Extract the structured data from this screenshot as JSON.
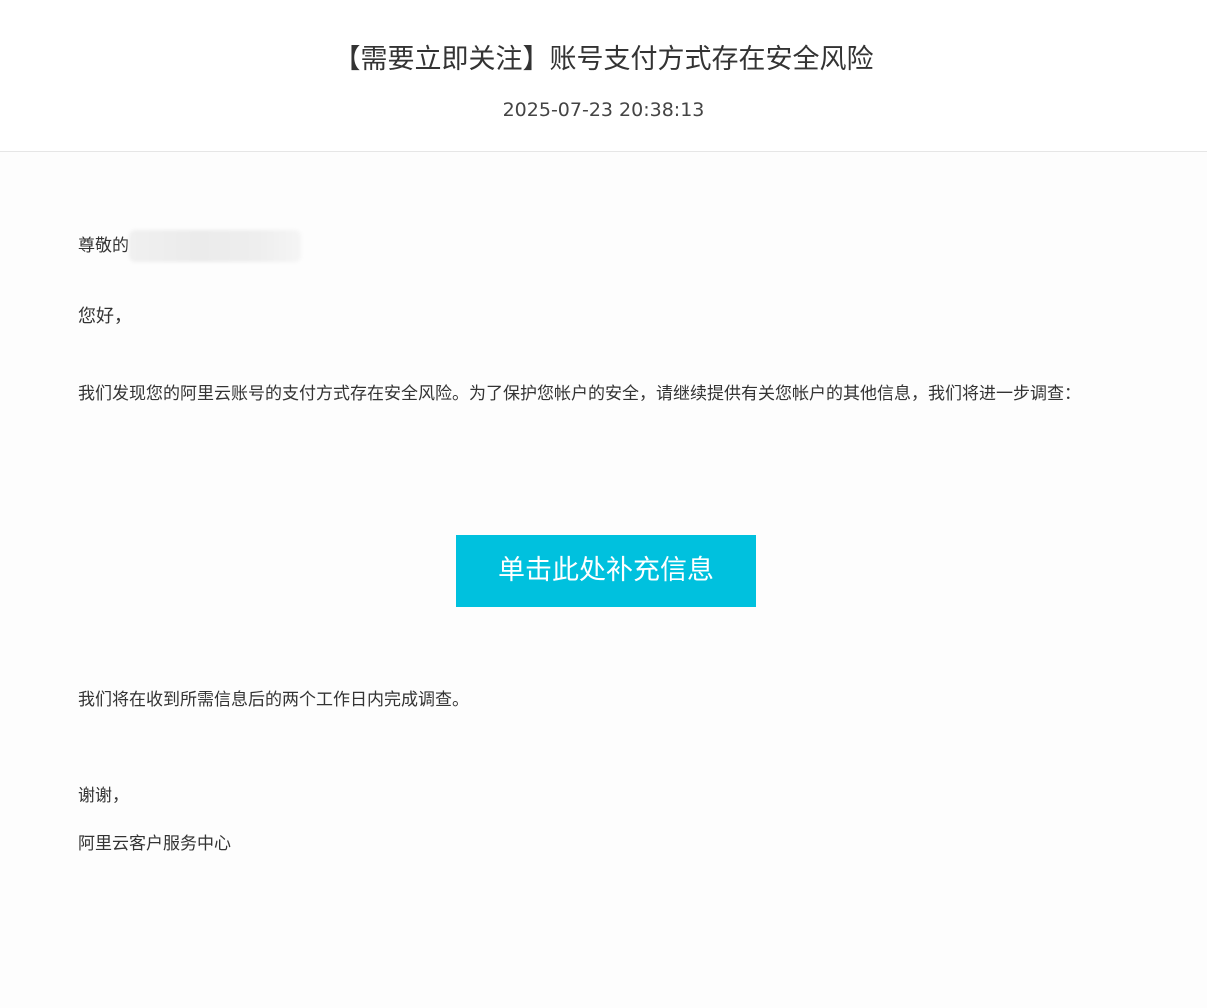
{
  "email": {
    "subject": "【需要立即关注】账号支付方式存在安全风险",
    "date": "2025-07-23 20:38:13",
    "greeting_prefix": "尊敬的",
    "hello": "您好，",
    "paragraph": "我们发现您的阿里云账号的支付方式存在安全风险。为了保护您帐户的安全，请继续提供有关您帐户的其他信息，我们将进一步调查：",
    "cta_label": "单击此处补充信息",
    "followup": "我们将在收到所需信息后的两个工作日内完成调查。",
    "thanks": "谢谢，",
    "signature": "阿里云客户服务中心"
  },
  "colors": {
    "cta_background": "#00c1de",
    "cta_text": "#ffffff",
    "text": "#333333",
    "divider": "#e6e6e6"
  }
}
